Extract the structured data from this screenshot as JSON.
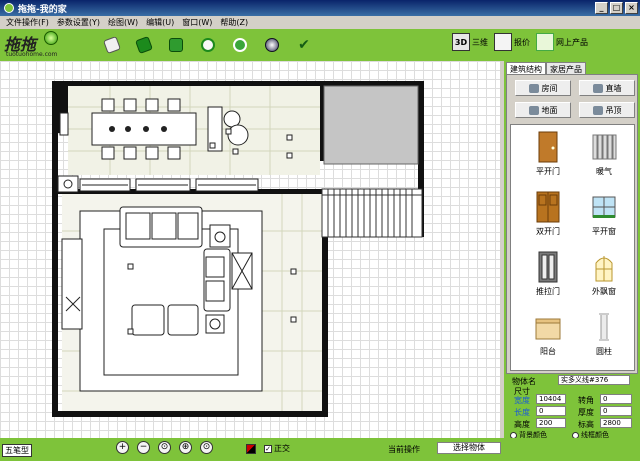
{
  "window": {
    "title": "拖拖-我的家",
    "minimize": "_",
    "maximize": "□",
    "close": "×"
  },
  "menu": [
    "文件操作(F)",
    "参数设置(Y)",
    "绘图(W)",
    "编辑(U)",
    "窗口(W)",
    "帮助(Z)"
  ],
  "logo": {
    "text": "拖拖",
    "url": "tuotuohome.com"
  },
  "toolbar": {
    "icons": [
      "new-file-icon",
      "open-file-icon",
      "save-icon",
      "refresh-icon",
      "settings-icon",
      "globe-icon",
      "checkmark-icon"
    ],
    "view3d": {
      "badge": "3D",
      "label": "三维"
    },
    "quote": {
      "label": "报价"
    },
    "online": {
      "label": "网上产品"
    }
  },
  "panel": {
    "tabs": [
      "建筑结构",
      "家居产品"
    ],
    "categories": [
      "房间",
      "直墙",
      "地面",
      "吊顶"
    ],
    "items": [
      "平开门",
      "暖气",
      "双开门",
      "平开窗",
      "推拉门",
      "外飘窗",
      "阳台",
      "圆柱"
    ]
  },
  "props": {
    "name_label": "物体名",
    "name_value": "实多义线#376",
    "size_label": "尺寸",
    "width_label": "宽度",
    "width_value": "10404",
    "length_label": "长度",
    "length_value": "0",
    "height_label": "高度",
    "height_value": "200",
    "rotation_label": "转角",
    "rotation_value": "0",
    "thickness_label": "厚度",
    "thickness_value": "0",
    "elevation_label": "标高",
    "elevation_value": "2800",
    "bg_color_label": "背景颜色",
    "line_color_label": "线框颜色"
  },
  "status": {
    "ime_mode": "五笔型",
    "zoom_buttons": [
      "+",
      "−",
      "⊙",
      "⊕",
      "⊙"
    ],
    "ortho_label": "正交",
    "ortho_mark": "✓",
    "current_op_label": "当前操作",
    "current_op_value": "选择物体"
  },
  "colors": {
    "accent": "#7ec33a",
    "title_bar": "#0a246a",
    "wall": "#111111",
    "floor": "#f1f2e6"
  }
}
